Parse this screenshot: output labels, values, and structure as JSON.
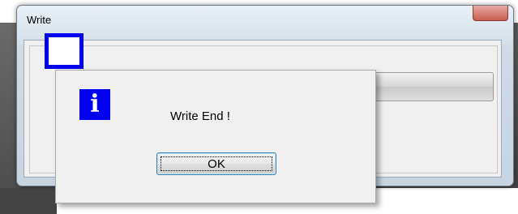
{
  "write_window": {
    "title": "Write"
  },
  "message_box": {
    "icon": "information-icon",
    "icon_glyph": "i",
    "message": "Write End !",
    "ok_label": "OK"
  },
  "colors": {
    "icon_blue": "#0000ee",
    "close_red": "#c95e52",
    "button_border": "#3c7fb1"
  }
}
